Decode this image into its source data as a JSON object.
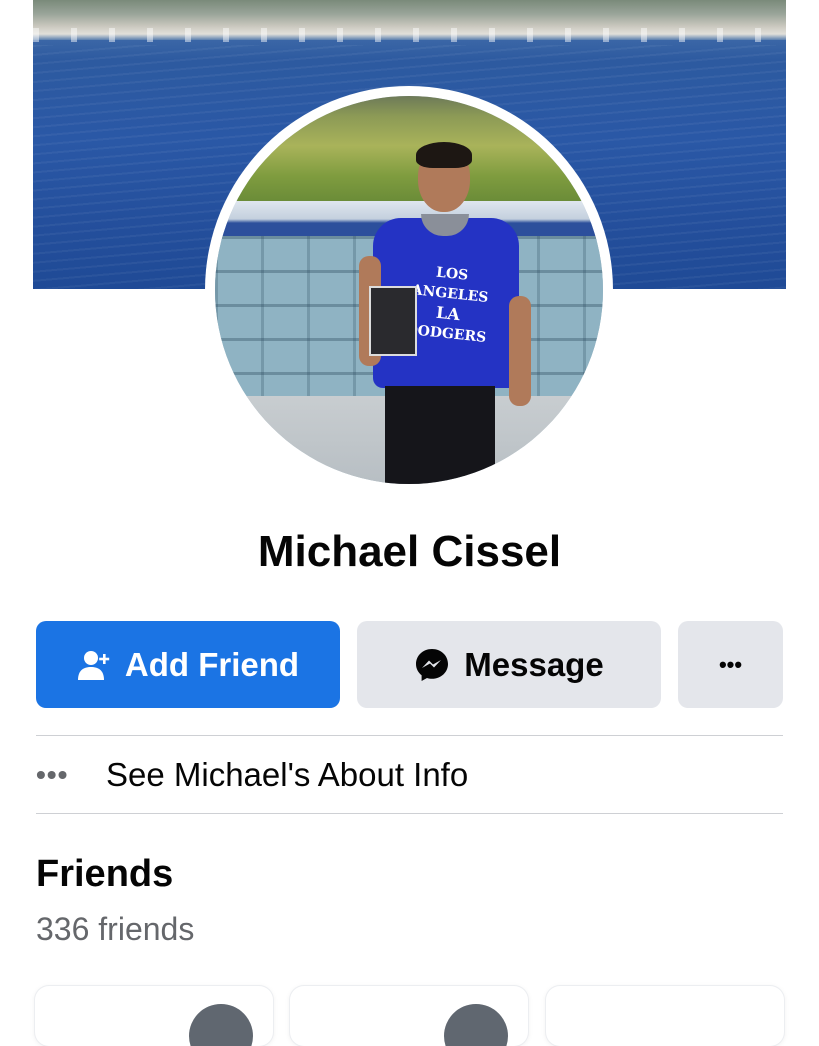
{
  "profile": {
    "name": "Michael Cissel",
    "cover_photo": "harbor-cover-photo",
    "avatar": "stadium-profile-photo",
    "shirt_text": {
      "line1": "LOS ANGELES",
      "line2": "LA",
      "line3": "DODGERS"
    }
  },
  "actions": {
    "add_friend_label": "Add Friend",
    "add_friend_icon": "person-add-icon",
    "message_label": "Message",
    "message_icon": "messenger-icon",
    "more_label": "•••"
  },
  "about": {
    "icon": "•••",
    "label": "See Michael's About Info"
  },
  "friends": {
    "title": "Friends",
    "count_label": "336 friends",
    "cards": [
      {
        "avatar": "friend-avatar"
      },
      {
        "avatar": "friend-avatar"
      },
      {
        "avatar": "friend-avatar"
      }
    ]
  },
  "colors": {
    "primary_blue": "#1b74e4",
    "secondary_gray": "#e4e6eb",
    "text_primary": "#050505",
    "text_secondary": "#65676b",
    "divider": "#ced0d4"
  }
}
